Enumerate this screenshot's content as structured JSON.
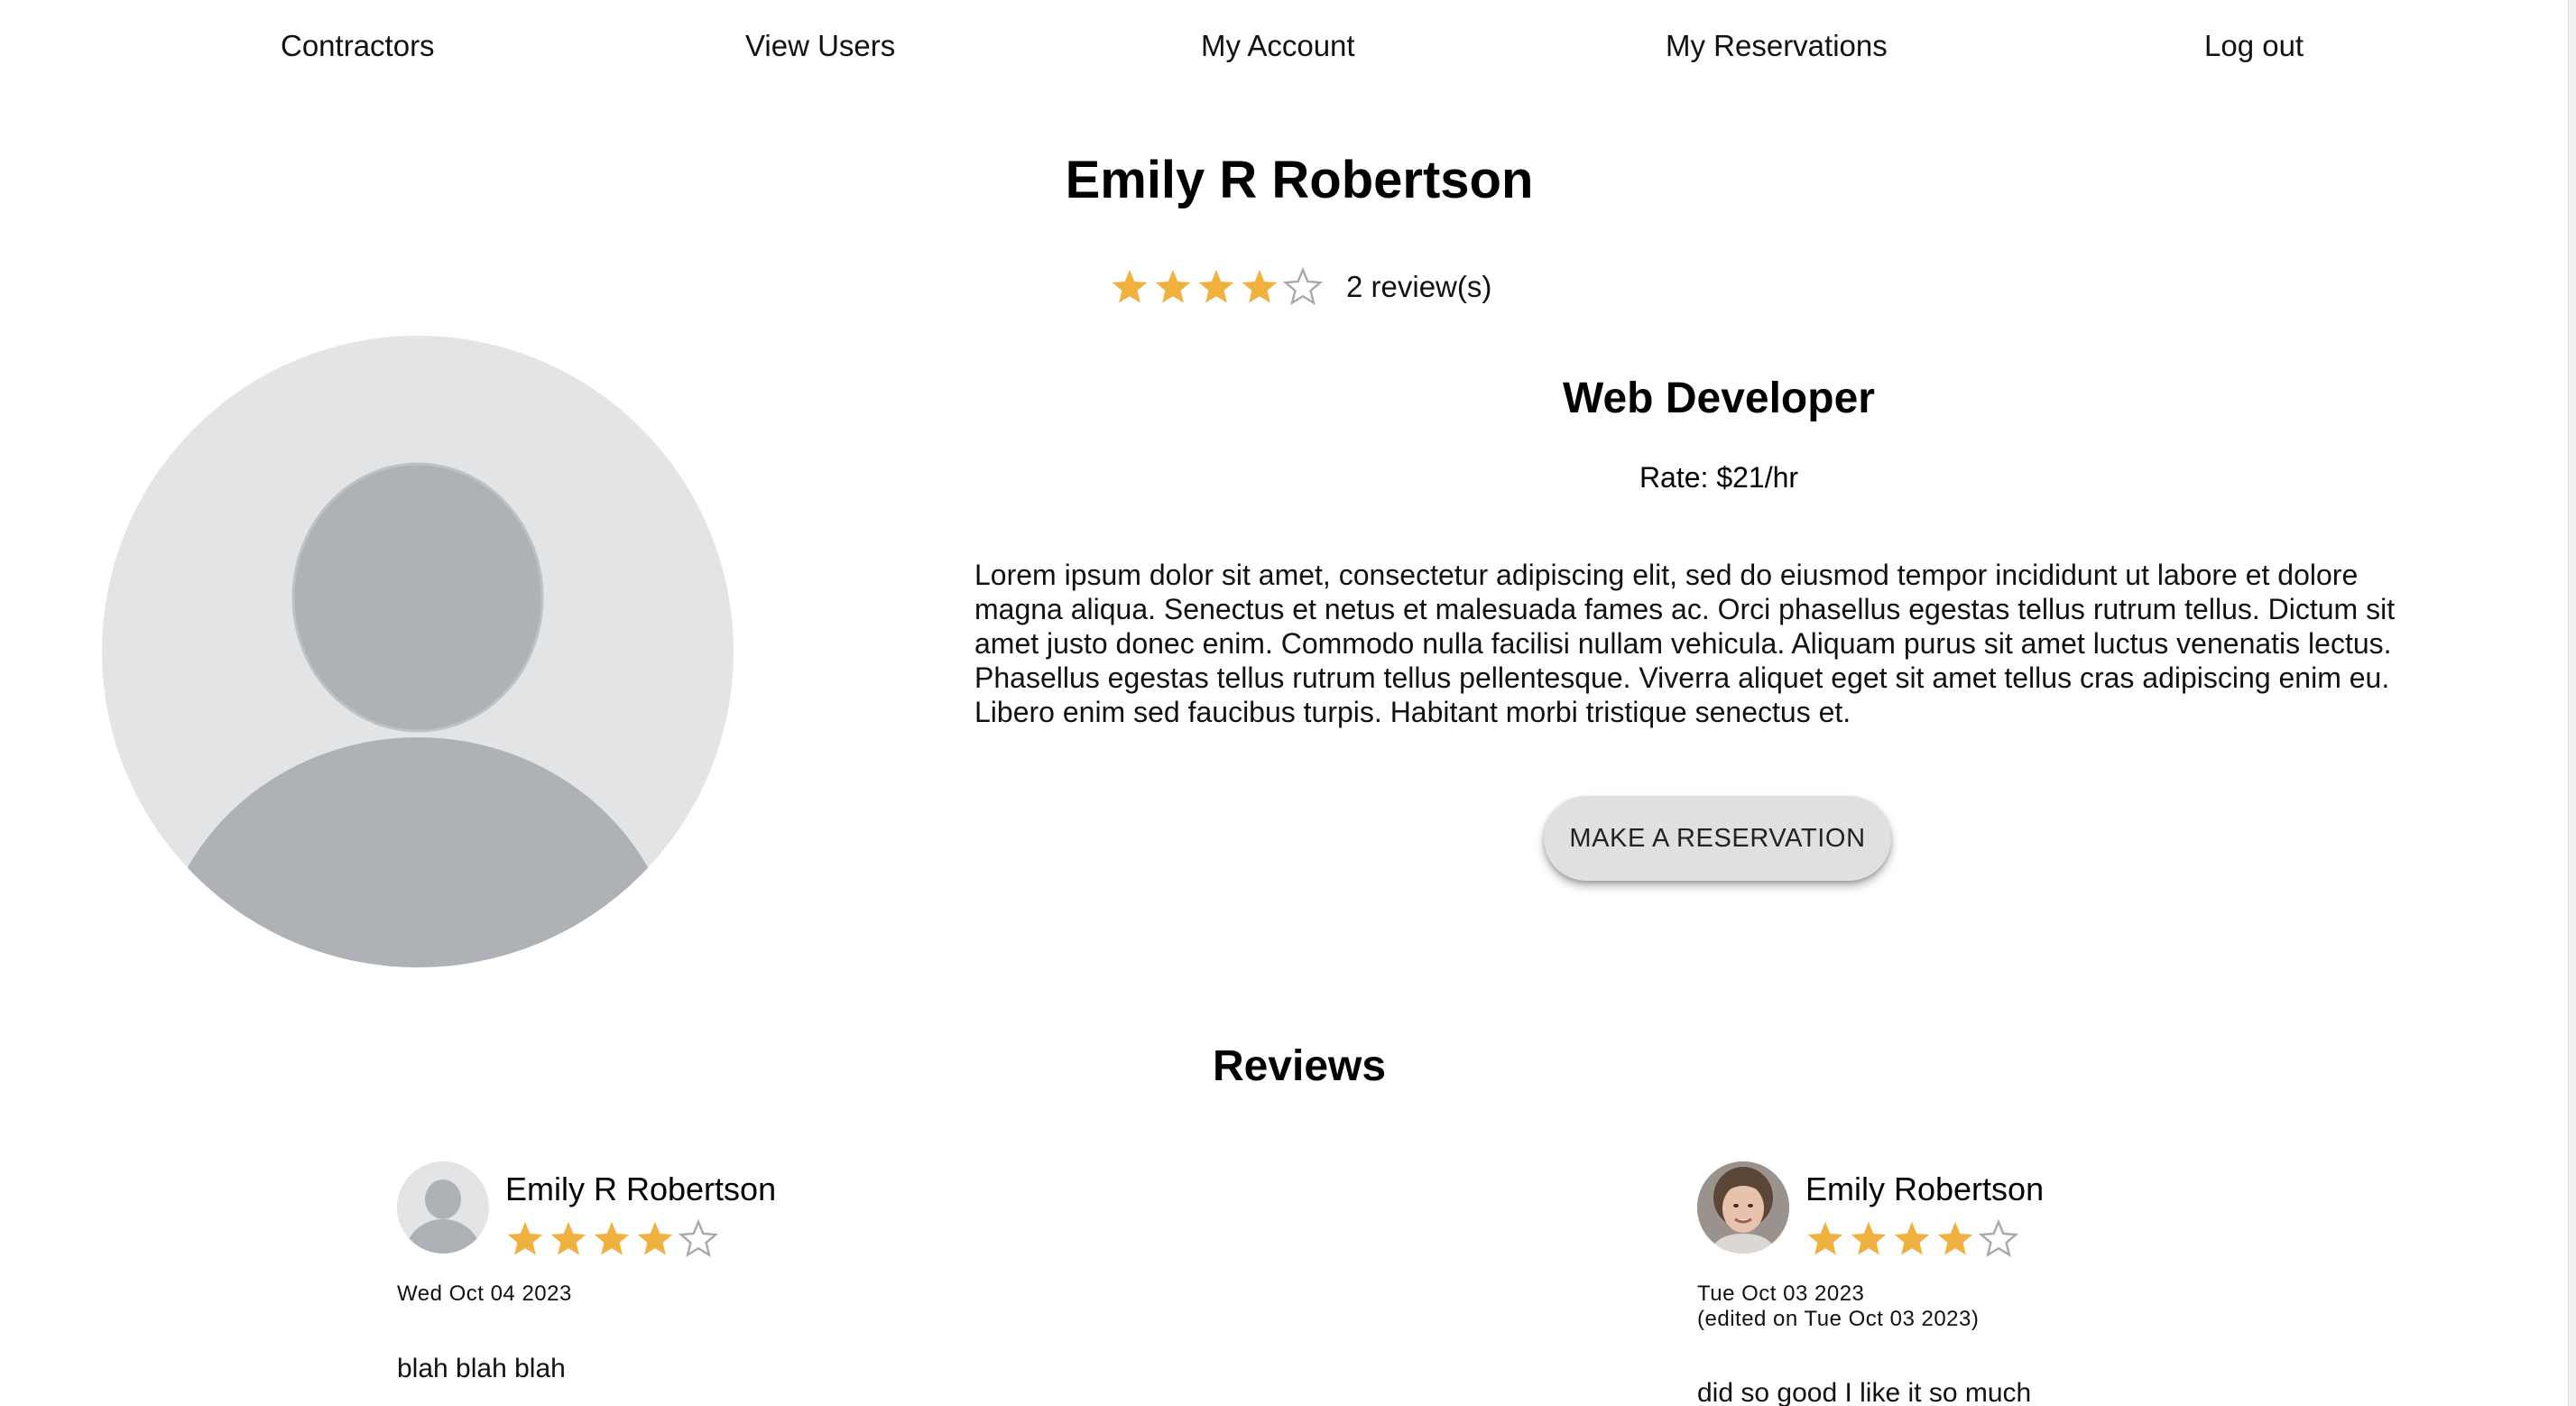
{
  "nav": {
    "contractors": "Contractors",
    "view_users": "View Users",
    "my_account": "My Account",
    "my_reservations": "My Reservations",
    "log_out": "Log out"
  },
  "profile": {
    "name": "Emily R Robertson",
    "rating": 4,
    "rating_max": 5,
    "review_count": "2 review(s)",
    "avatar_icon": "default-user-avatar-icon",
    "job_title": "Web Developer",
    "rate": "Rate: $21/hr",
    "bio": "Lorem ipsum dolor sit amet, consectetur adipiscing elit, sed do eiusmod tempor incididunt ut labore et dolore magna aliqua. Senectus et netus et malesuada fames ac. Orci phasellus egestas tellus rutrum tellus. Dictum sit amet justo donec enim. Commodo nulla facilisi nullam vehicula. Aliquam purus sit amet luctus venenatis lectus. Phasellus egestas tellus rutrum tellus pellentesque. Viverra aliquet eget sit amet tellus cras adipiscing enim eu. Libero enim sed faucibus turpis. Habitant morbi tristique senectus et.",
    "reserve_button": "MAKE A RESERVATION"
  },
  "reviews": {
    "title": "Reviews",
    "items": [
      {
        "author": "Emily R Robertson",
        "avatar_icon": "default-user-avatar-icon",
        "rating": 4,
        "date": "Wed Oct 04 2023",
        "edited": "",
        "text": "blah blah blah"
      },
      {
        "author": "Emily Robertson",
        "avatar_icon": "user-photo-avatar",
        "rating": 4,
        "date": "Tue Oct 03 2023",
        "edited": "(edited on Tue Oct 03 2023)",
        "text": "did so good I like it so much"
      }
    ]
  },
  "colors": {
    "star_filled": "#F0B13F",
    "star_empty": "#A8A8A8",
    "avatar_bg": "#E3E4E6",
    "avatar_fg": "#AEB1B5",
    "button_bg": "#E0E0E0"
  }
}
